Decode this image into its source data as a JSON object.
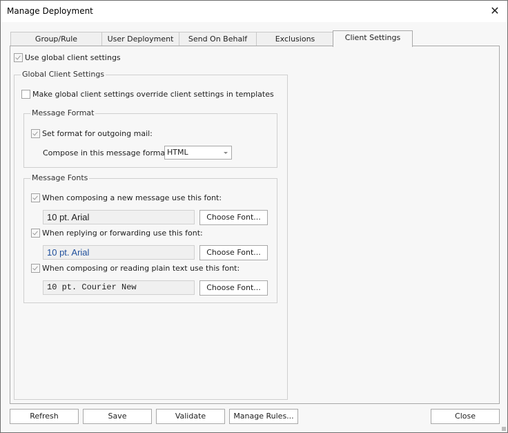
{
  "window": {
    "title": "Manage Deployment",
    "close_icon": "close-icon"
  },
  "tabs": [
    {
      "label": "Group/Rule Deployment",
      "active": false
    },
    {
      "label": "User Deployment",
      "active": false
    },
    {
      "label": "Send On Behalf",
      "active": false
    },
    {
      "label": "Exclusions",
      "active": false
    },
    {
      "label": "Client Settings",
      "active": true
    }
  ],
  "client_settings": {
    "use_global": {
      "label": "Use global client settings",
      "checked": true
    },
    "global_group": {
      "legend": "Global Client Settings",
      "override": {
        "label": "Make global client settings override client settings in templates",
        "checked": false
      },
      "message_format": {
        "legend": "Message Format",
        "set_format": {
          "label": "Set format for outgoing mail:",
          "checked": true
        },
        "compose_label": "Compose in this message format:",
        "format_value": "HTML"
      },
      "message_fonts": {
        "legend": "Message Fonts",
        "items": [
          {
            "label": "When composing a new message use this font:",
            "checked": true,
            "value": "10 pt. Arial",
            "button": "Choose Font..."
          },
          {
            "label": "When replying or forwarding use this font:",
            "checked": true,
            "value": "10 pt. Arial",
            "button": "Choose Font..."
          },
          {
            "label": "When composing or reading plain text use this font:",
            "checked": true,
            "value": "10 pt. Courier New",
            "button": "Choose Font..."
          }
        ]
      }
    }
  },
  "footer": {
    "refresh": "Refresh",
    "save": "Save",
    "validate": "Validate",
    "manage_rules": "Manage Rules...",
    "close": "Close"
  }
}
